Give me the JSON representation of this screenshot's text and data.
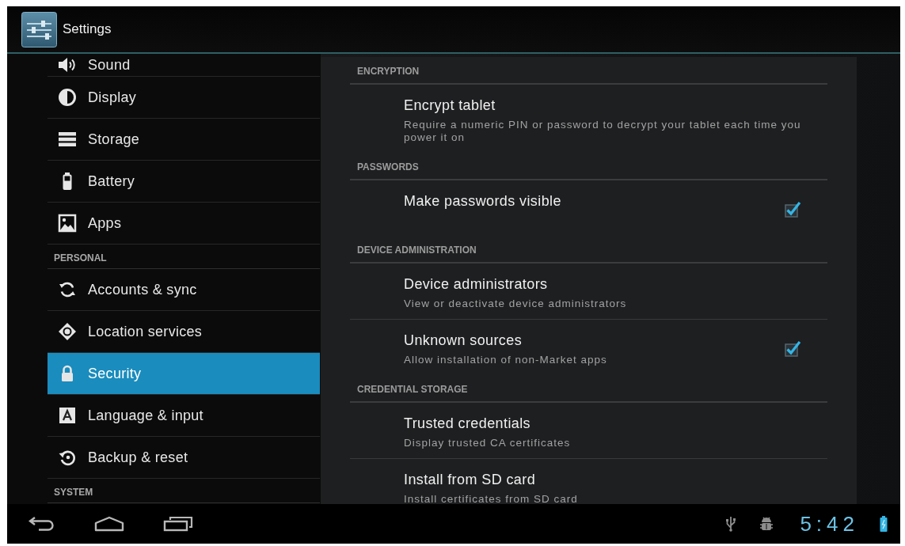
{
  "action_bar": {
    "title": "Settings"
  },
  "sidebar": {
    "items": [
      {
        "kind": "item",
        "label": "Sound",
        "selected": false
      },
      {
        "kind": "item",
        "label": "Display",
        "selected": false
      },
      {
        "kind": "item",
        "label": "Storage",
        "selected": false
      },
      {
        "kind": "item",
        "label": "Battery",
        "selected": false
      },
      {
        "kind": "item",
        "label": "Apps",
        "selected": false
      },
      {
        "kind": "header",
        "label": "PERSONAL"
      },
      {
        "kind": "item",
        "label": "Accounts & sync",
        "selected": false
      },
      {
        "kind": "item",
        "label": "Location services",
        "selected": false
      },
      {
        "kind": "item",
        "label": "Security",
        "selected": true
      },
      {
        "kind": "item",
        "label": "Language & input",
        "selected": false
      },
      {
        "kind": "item",
        "label": "Backup & reset",
        "selected": false
      },
      {
        "kind": "header",
        "label": "SYSTEM"
      }
    ]
  },
  "detail": {
    "sections": [
      {
        "header": "ENCRYPTION",
        "items": [
          {
            "kind": "plain",
            "title": "Encrypt tablet",
            "summary": "Require a numeric PIN or password to decrypt your tablet each time you power it on"
          }
        ]
      },
      {
        "header": "PASSWORDS",
        "items": [
          {
            "kind": "checkbox",
            "title": "Make passwords visible",
            "checked": true
          }
        ]
      },
      {
        "header": "DEVICE ADMINISTRATION",
        "items": [
          {
            "kind": "plain",
            "title": "Device administrators",
            "summary": "View or deactivate device administrators"
          },
          {
            "kind": "checkbox",
            "title": "Unknown sources",
            "summary": "Allow installation of non-Market apps",
            "checked": true
          }
        ]
      },
      {
        "header": "CREDENTIAL STORAGE",
        "items": [
          {
            "kind": "plain",
            "title": "Trusted credentials",
            "summary": "Display trusted CA certificates"
          },
          {
            "kind": "plain",
            "title": "Install from SD card",
            "summary": "Install certificates from SD card"
          }
        ]
      }
    ]
  },
  "status_bar": {
    "time": "5:42"
  }
}
